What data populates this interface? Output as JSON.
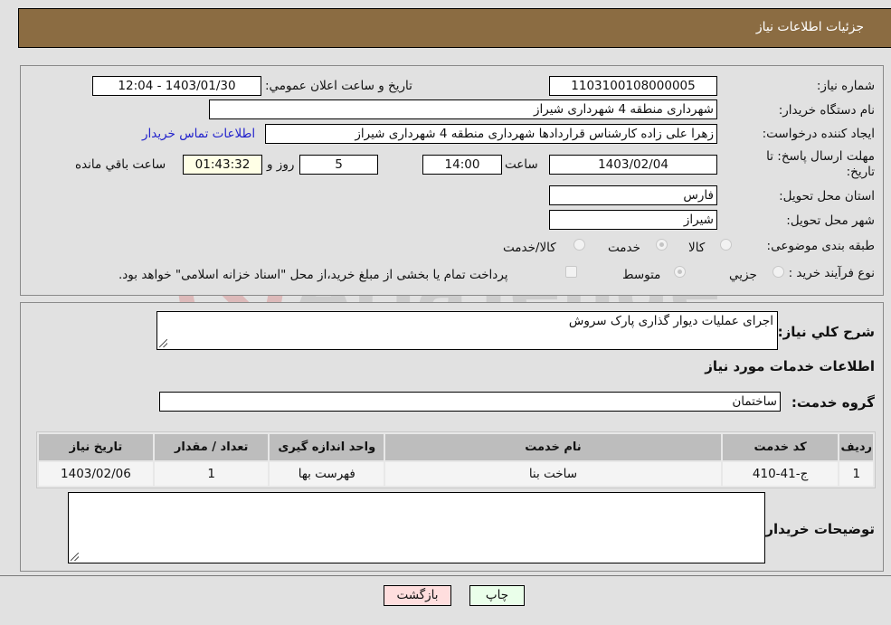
{
  "header": {
    "title": "جزئيات اطلاعات نياز"
  },
  "form": {
    "need_number": {
      "label": "شماره نياز:",
      "value": "1103100108000005"
    },
    "announce_datetime": {
      "label": "تاريخ و ساعت اعلان عمومي:",
      "value": "1403/01/30 - 12:04"
    },
    "buyer_org": {
      "label": "نام دستگاه خريدار:",
      "value": "شهرداری منطقه 4 شهرداری شیراز"
    },
    "requester": {
      "label": "ايجاد کننده درخواست:",
      "value": "زهرا علی زاده کارشناس قراردادها شهرداری منطقه 4 شهرداری شیراز",
      "contact_link": "اطلاعات تماس خريدار"
    },
    "deadline": {
      "label_line1": "مهلت ارسال پاسخ: تا",
      "label_line2": "تاريخ:",
      "date": "1403/02/04",
      "time_label": "ساعت",
      "time": "14:00",
      "days": "5",
      "days_label": "روز و",
      "remaining": "01:43:32",
      "remaining_label": "ساعت باقي مانده"
    },
    "province": {
      "label": "استان محل تحويل:",
      "value": "فارس"
    },
    "city": {
      "label": "شهر محل تحويل:",
      "value": "شیراز"
    },
    "category": {
      "label": "طبقه بندی موضوعی:",
      "options": [
        {
          "label": "کالا",
          "checked": false
        },
        {
          "label": "خدمت",
          "checked": true
        },
        {
          "label": "کالا/خدمت",
          "checked": false
        }
      ]
    },
    "purchase_process": {
      "label": "نوع فرآيند خريد :",
      "options": [
        {
          "label": "جزيي",
          "checked": false
        },
        {
          "label": "متوسط",
          "checked": true
        }
      ],
      "treasury_checkbox": {
        "label": "پرداخت تمام يا بخشی از مبلغ خريد،از محل \"اسناد خزانه اسلامی\" خواهد بود.",
        "checked": false
      }
    }
  },
  "details": {
    "description_label": "شرح کلي نياز:",
    "description_value": "اجرای عملیات دیوار گذاری پارک سروش",
    "services_heading": "اطلاعات خدمات مورد نياز",
    "service_group_label": "گروه خدمت:",
    "service_group_value": "ساختمان",
    "table": {
      "headers": [
        "رديف",
        "کد خدمت",
        "نام خدمت",
        "واحد اندازه گيری",
        "تعداد / مقدار",
        "تاريخ نياز"
      ],
      "rows": [
        [
          "1",
          "ج-41-410",
          "ساخت بنا",
          "فهرست بها",
          "1",
          "1403/02/06"
        ]
      ]
    },
    "buyer_notes_label": "توضيحات خريدار:",
    "buyer_notes_value": ""
  },
  "buttons": {
    "print": "چاپ",
    "back": "بازگشت"
  },
  "watermark": {
    "text": "AriaTender.neT"
  }
}
